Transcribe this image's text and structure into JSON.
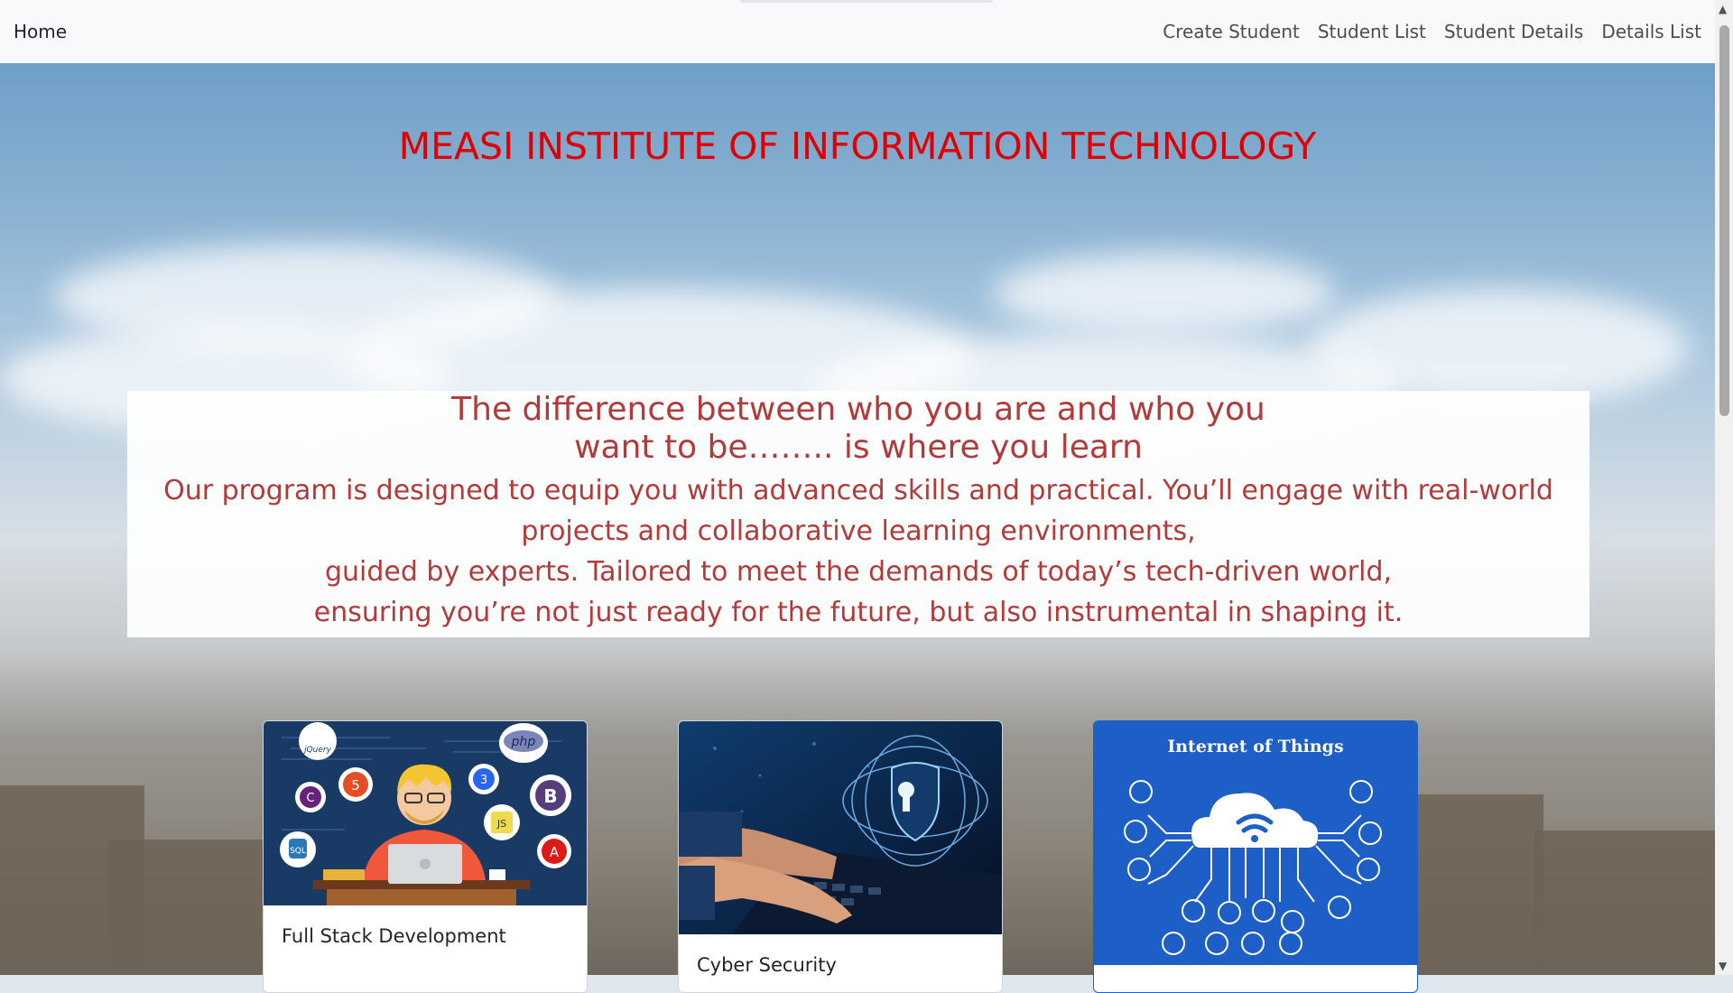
{
  "navbar": {
    "brand": "Home",
    "links": [
      "Create Student",
      "Student List",
      "Student Details",
      "Details List"
    ]
  },
  "hero": {
    "title": "MEASI INSTITUTE OF INFORMATION TECHNOLOGY",
    "quote_lines": [
      "The difference between who you are and who you",
      "want to be…….. is where you learn"
    ],
    "description_lines": [
      "Our program is designed to equip you with advanced skills and practical. You’ll engage with real-world",
      "projects and collaborative learning environments,",
      "guided by experts. Tailored to meet the demands of today’s tech-driven world,",
      "ensuring you’re not just ready for the future, but also instrumental in shaping it."
    ]
  },
  "cards": [
    {
      "title": "Full Stack Development",
      "badges": [
        "jQuery",
        "php",
        "5",
        "3",
        "C",
        "B",
        "JS",
        "SQL",
        "A"
      ]
    },
    {
      "title": "Cyber Security"
    },
    {
      "heading": "Internet of Things"
    }
  ],
  "colors": {
    "title_red": "#e00000",
    "text_red": "#b23a3a",
    "navbar_bg": "#f8f9fa",
    "iot_blue": "#1d5fc6"
  }
}
